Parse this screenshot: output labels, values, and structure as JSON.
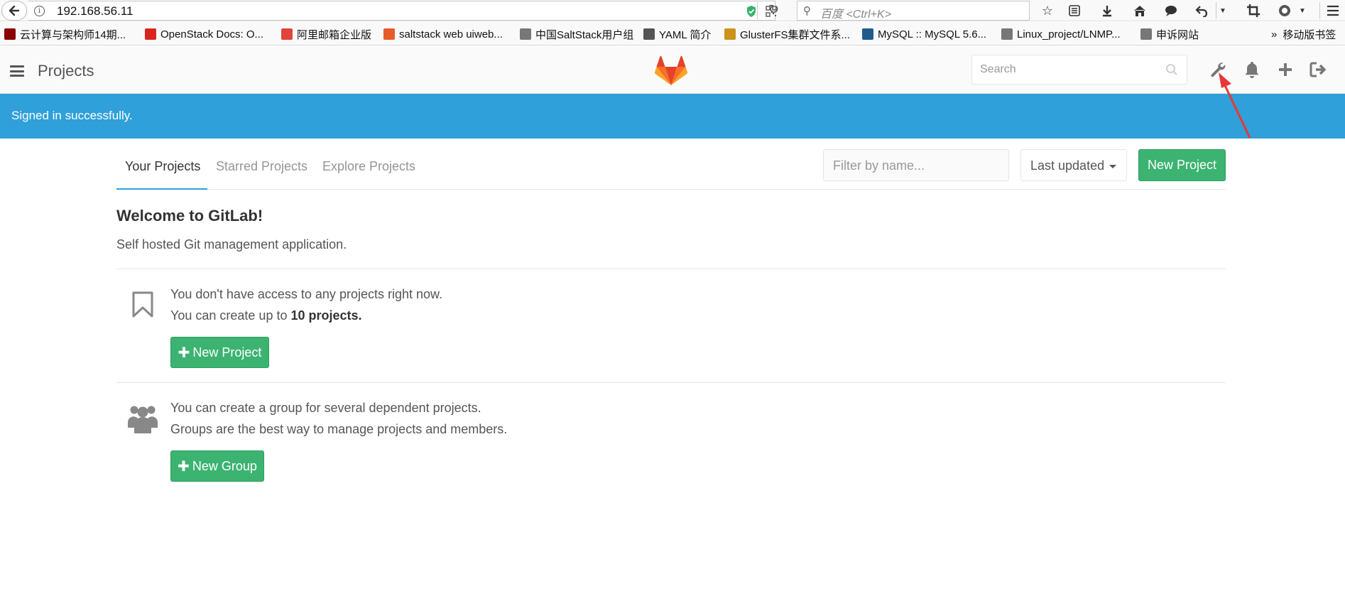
{
  "browser": {
    "url": "192.168.56.11",
    "search_placeholder": "百度 <Ctrl+K>",
    "bookmarks": [
      {
        "label": "云计算与架构师14期...",
        "color": "#8b0000"
      },
      {
        "label": "OpenStack Docs: O...",
        "color": "#d9261c"
      },
      {
        "label": "阿里邮箱企业版",
        "color": "#e0443d"
      },
      {
        "label": "saltstack web uiweb...",
        "color": "#e65b2a"
      },
      {
        "label": "中国SaltStack用户组",
        "color": "#777777"
      },
      {
        "label": "YAML 简介",
        "color": "#555555"
      },
      {
        "label": "GlusterFS集群文件系...",
        "color": "#c99419"
      },
      {
        "label": "MySQL :: MySQL 5.6...",
        "color": "#1f5c8b"
      },
      {
        "label": "Linux_project/LNMP...",
        "color": "#777777"
      },
      {
        "label": "申诉网站",
        "color": "#777777"
      }
    ],
    "bookmarks_overflow": "»",
    "mobile_bookmarks": "移动版书签"
  },
  "header": {
    "title": "Projects",
    "search_placeholder": "Search"
  },
  "flash": {
    "message": "Signed in successfully."
  },
  "tabs": [
    {
      "label": "Your Projects",
      "active": true
    },
    {
      "label": "Starred Projects",
      "active": false
    },
    {
      "label": "Explore Projects",
      "active": false
    }
  ],
  "controls": {
    "filter_placeholder": "Filter by name...",
    "sort_label": "Last updated",
    "new_project_label": "New Project"
  },
  "welcome": {
    "title": "Welcome to GitLab!",
    "subtitle": "Self hosted Git management application."
  },
  "projects_block": {
    "line1": "You don't have access to any projects right now.",
    "line2_prefix": "You can create up to ",
    "line2_bold": "10 projects.",
    "button_label": "New Project"
  },
  "groups_block": {
    "line1": "You can create a group for several dependent projects.",
    "line2": "Groups are the best way to manage projects and members.",
    "button_label": "New Group"
  },
  "colors": {
    "flash": "#2fa0d9",
    "button_green": "#3cb371",
    "annotation_arrow": "#e53935"
  }
}
